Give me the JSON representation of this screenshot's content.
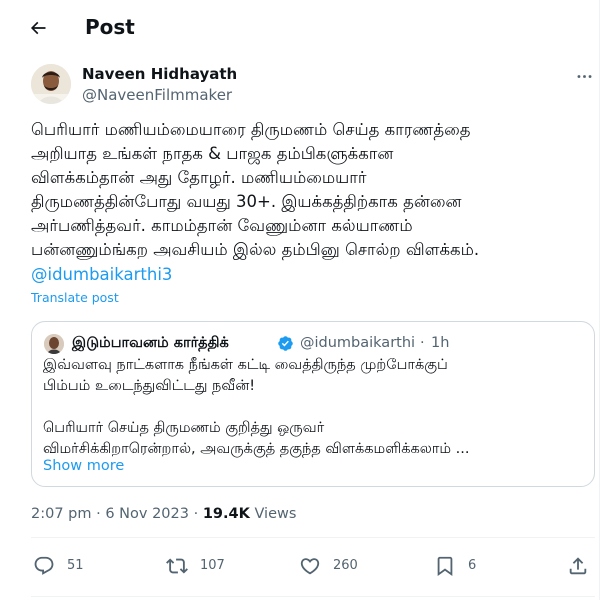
{
  "header": {
    "title": "Post"
  },
  "author": {
    "name": "Naveen Hidhayath",
    "handle": "@NaveenFilmmaker"
  },
  "post": {
    "text": "பெரியார் மணியம்மையாரை திருமணம் செய்த காரணத்தை\nஅறியாத உங்கள் நாதக & பாஜக தம்பிகளுக்கான\nவிளக்கம்தான் அது தோழர். மணியம்மையார்\nதிருமணத்தின்போது வயது 30+. இயக்கத்திற்காக தன்னை\nஅர்பணித்தவர். காமம்தான் வேணும்னா கல்யாணம்\nபன்னணும்ங்கற அவசியம் இல்ல தம்பினு சொல்ற விளக்கம்.",
    "mention": "@idumbaikarthi3",
    "translate_label": "Translate post"
  },
  "quote": {
    "name": "இடும்பாவனம் கார்த்திக்",
    "handle": "@idumbaikarthi",
    "separator": "·",
    "time": "1h",
    "lines": [
      "இவ்வளவு நாட்களாக நீங்கள் கட்டி வைத்திருந்த முற்போக்குப்",
      "பிம்பம் உடைந்துவிட்டது நவீன்!",
      "",
      "பெரியார் செய்த திருமணம் குறித்து ஒருவர்",
      "விமர்சிக்கிறாரென்றால், அவருக்குத் தகுந்த விளக்கமளிக்கலாம் ..."
    ],
    "show_more": "Show more"
  },
  "meta": {
    "time": "2:07 pm",
    "separator": "·",
    "date": "6 Nov 2023",
    "sep2": "·",
    "views": "19.4K",
    "views_label": "Views"
  },
  "actions": {
    "replies": "51",
    "reposts": "107",
    "likes": "260",
    "bookmarks": "6"
  },
  "icons": {
    "back": "arrow-left-icon",
    "more": "more-horizontal-icon",
    "verified": "verified-badge-icon",
    "reply": "reply-icon",
    "repost": "repost-icon",
    "like": "heart-icon",
    "bookmark": "bookmark-icon",
    "share": "share-icon"
  },
  "colors": {
    "accent": "#1d9bf0",
    "text": "#0f1419",
    "muted": "#536471",
    "border": "#cfd9de"
  }
}
